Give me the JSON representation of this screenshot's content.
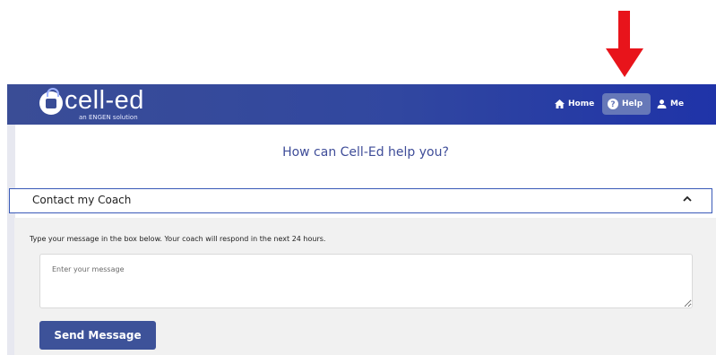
{
  "brand": {
    "name": "cell-ed",
    "tagline": "an ENGEN solution"
  },
  "nav": {
    "home_label": "Home",
    "help_label": "Help",
    "me_label": "Me"
  },
  "page": {
    "title": "How can Cell-Ed help you?"
  },
  "accordion": {
    "label": "Contact my Coach",
    "expanded": true
  },
  "contact_form": {
    "hint": "Type your message in the box below. Your coach will respond in the next 24 hours.",
    "message_value": "",
    "message_placeholder": "Enter your message",
    "send_label": "Send Message"
  },
  "colors": {
    "header_start": "#3a4d96",
    "header_end": "#1f33a8",
    "accent": "#3d5299",
    "annotation_arrow": "#e8141b"
  },
  "icons": [
    "annotation-arrow",
    "home-icon",
    "help-icon",
    "user-icon",
    "chevron-up-icon"
  ]
}
